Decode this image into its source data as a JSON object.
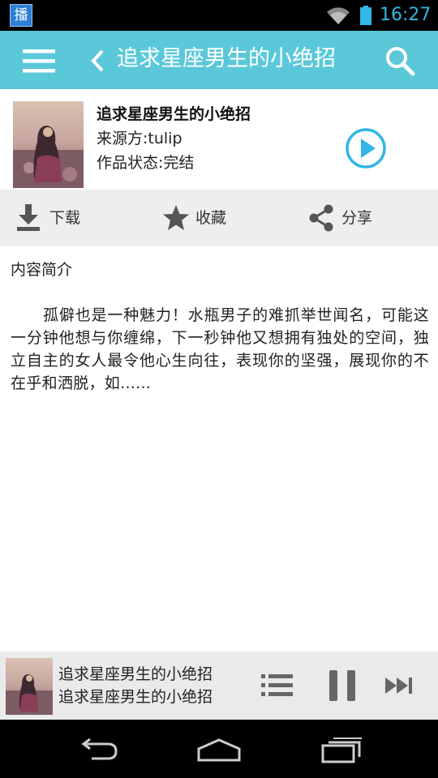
{
  "status_bar": {
    "app_badge": "播",
    "time": "16:27"
  },
  "header": {
    "title": "追求星座男生的小绝招"
  },
  "book": {
    "title": "追求星座男生的小绝招",
    "source": "来源方:tulip",
    "status": "作品状态:完结"
  },
  "actions": {
    "download": "下载",
    "favorite": "收藏",
    "share": "分享"
  },
  "intro": {
    "label": "内容简介",
    "text": "孤僻也是一种魅力！水瓶男子的难抓举世闻名，可能这一分钟他想与你缠绵，下一秒钟他又想拥有独处的空间，独立自主的女人最令他心生向往，表现你的坚强，展现你的不在乎和洒脱，如......"
  },
  "player": {
    "title": "追求星座男生的小绝招",
    "subtitle": "追求星座男生的小绝招"
  },
  "colors": {
    "header_bg": "#5bc8d9",
    "accent": "#33b5e5",
    "action_bar_bg": "#eeeeee",
    "player_bg": "#eaeaea"
  }
}
